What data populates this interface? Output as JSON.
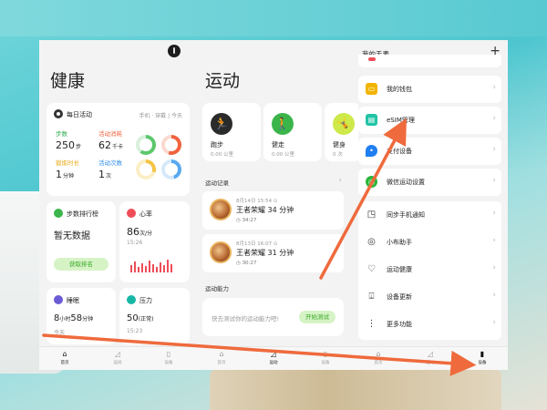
{
  "health": {
    "title": "健康",
    "activity": {
      "title": "每日活动",
      "meta": "手机 · 穿戴 | 今天",
      "steps_label": "步数",
      "steps_value": "250",
      "steps_unit": "步",
      "calories_label": "活动消耗",
      "calories_value": "62",
      "calories_unit": "千卡",
      "active_label": "锻炼时长",
      "active_value": "1",
      "active_unit": "分钟",
      "count_label": "活动次数",
      "count_value": "1",
      "count_unit": "次"
    },
    "steps_rank": {
      "title": "步数排行榜",
      "value": "暂无数据",
      "button": "获取排名"
    },
    "heart_rate": {
      "title": "心率",
      "value": "86",
      "unit": "次/分",
      "time": "15:26"
    },
    "sleep": {
      "title": "睡眠",
      "hours": "8",
      "hours_unit": "小时",
      "minutes": "58",
      "minutes_unit": "分钟",
      "day": "今天"
    },
    "stress": {
      "title": "压力",
      "value": "50",
      "level": "(正常)",
      "time": "15:23"
    }
  },
  "sport": {
    "title": "运动",
    "tiles": [
      {
        "name": "跑步",
        "sub": "0.00 公里",
        "color": "#2b2b2b"
      },
      {
        "name": "健走",
        "sub": "0.00 公里",
        "color": "#3bb54a"
      },
      {
        "name": "健身",
        "sub": "0 次",
        "color": "#cde94a"
      }
    ],
    "records_label": "运动记录",
    "records": [
      {
        "date": "8月14日 15:54 ⊙",
        "title": "王者荣耀 34 分钟",
        "duration": "34:27"
      },
      {
        "date": "8月13日 16:07 ⊙",
        "title": "王者荣耀 31 分钟",
        "duration": "30:27"
      }
    ],
    "ability_label": "运动能力",
    "ability_text": "快去测试你的运动能力吧!",
    "ability_button": "开始测试"
  },
  "watch": {
    "title": "我的手表",
    "plus": "+",
    "items": [
      {
        "label": "我的钱包",
        "icon": "wallet-icon",
        "color": "#f2b400"
      },
      {
        "label": "eSIM管理",
        "icon": "esim-icon",
        "color": "#21c4a6"
      },
      {
        "label": "支付设备",
        "icon": "location-icon",
        "color": "#1f7ff0"
      },
      {
        "label": "微信运动设置",
        "icon": "wechat-icon",
        "color": "#2ab53b"
      },
      {
        "label": "同步手机通知",
        "icon": "notification-icon",
        "color": "#333333"
      },
      {
        "label": "小布助手",
        "icon": "assistant-icon",
        "color": "#333333"
      },
      {
        "label": "运动健康",
        "icon": "heart-icon",
        "color": "#333333"
      },
      {
        "label": "设备更新",
        "icon": "update-icon",
        "color": "#333333"
      },
      {
        "label": "更多功能",
        "icon": "more-icon",
        "color": "#333333"
      }
    ]
  },
  "tabs": [
    {
      "label": "首页",
      "icon": "home-icon"
    },
    {
      "label": "运动",
      "icon": "shoe-icon"
    },
    {
      "label": "设备",
      "icon": "watch-icon"
    },
    {
      "label": "首页",
      "icon": "home-icon"
    },
    {
      "label": "运动",
      "icon": "shoe-icon"
    },
    {
      "label": "设备",
      "icon": "watch-icon"
    },
    {
      "label": "首页",
      "icon": "home-icon"
    },
    {
      "label": "运动",
      "icon": "shoe-icon"
    },
    {
      "label": "设备",
      "icon": "watch-icon"
    }
  ],
  "colors": {
    "annotation_arrow": "#ef6a3c",
    "accent_green": "#3aa82a"
  }
}
